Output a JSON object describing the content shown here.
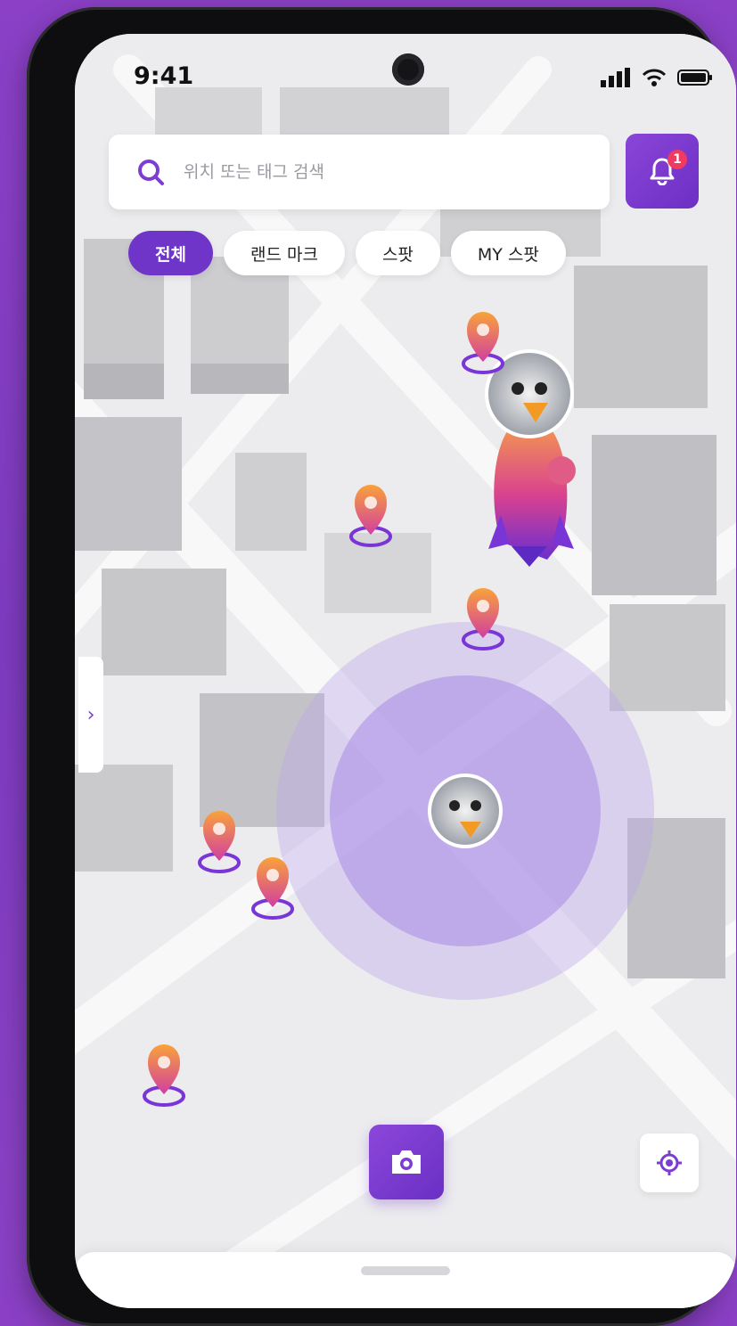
{
  "status_bar": {
    "time": "9:41"
  },
  "search": {
    "placeholder": "위치 또는 태그 검색"
  },
  "notifications": {
    "count": "1"
  },
  "filters": [
    {
      "label": "전체",
      "active": true
    },
    {
      "label": "랜드 마크",
      "active": false
    },
    {
      "label": "스팟",
      "active": false
    },
    {
      "label": "MY 스팟",
      "active": false
    }
  ],
  "side_tab": {
    "glyph": "›"
  },
  "colors": {
    "accent": "#6f35c9",
    "badge": "#f03a5f"
  },
  "icons": {
    "search": "search-icon",
    "bell": "bell-icon",
    "camera": "camera-icon",
    "locate": "locate-icon",
    "pin": "map-pin-icon"
  }
}
